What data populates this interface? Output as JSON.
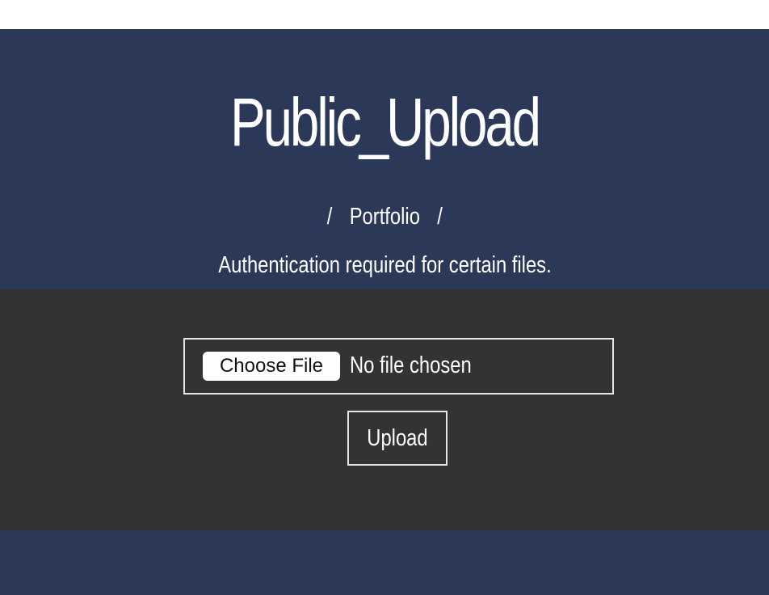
{
  "header": {
    "title": "Public_Upload",
    "breadcrumb": {
      "separator": "/",
      "items": [
        "Portfolio"
      ]
    },
    "subtitle": "Authentication required for certain files."
  },
  "upload_form": {
    "choose_file_label": "Choose File",
    "file_status": "No file chosen",
    "upload_label": "Upload"
  },
  "colors": {
    "header_bg": "#2c3858",
    "main_bg": "#333333",
    "text": "#ffffff",
    "border": "#e6e6e6"
  }
}
